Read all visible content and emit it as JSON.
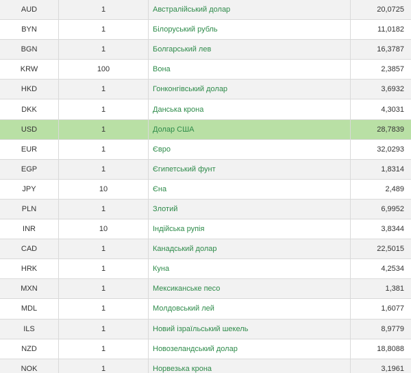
{
  "table": {
    "highlight_color": "#b9e0a5",
    "link_color": "#2e8b4a",
    "stripe_color": "#f2f2f2",
    "rows": [
      {
        "code": "AUD",
        "units": "1",
        "name": "Австралійський долар",
        "rate": "20,0725",
        "highlight": false
      },
      {
        "code": "BYN",
        "units": "1",
        "name": "Білоруський рубль",
        "rate": "11,0182",
        "highlight": false
      },
      {
        "code": "BGN",
        "units": "1",
        "name": "Болгарський лев",
        "rate": "16,3787",
        "highlight": false
      },
      {
        "code": "KRW",
        "units": "100",
        "name": "Вона",
        "rate": "2,3857",
        "highlight": false
      },
      {
        "code": "HKD",
        "units": "1",
        "name": "Гонконгівський долар",
        "rate": "3,6932",
        "highlight": false
      },
      {
        "code": "DKK",
        "units": "1",
        "name": "Данська крона",
        "rate": "4,3031",
        "highlight": false
      },
      {
        "code": "USD",
        "units": "1",
        "name": "Долар США",
        "rate": "28,7839",
        "highlight": true
      },
      {
        "code": "EUR",
        "units": "1",
        "name": "Євро",
        "rate": "32,0293",
        "highlight": false
      },
      {
        "code": "EGP",
        "units": "1",
        "name": "Єгипетський фунт",
        "rate": "1,8314",
        "highlight": false
      },
      {
        "code": "JPY",
        "units": "10",
        "name": "Єна",
        "rate": "2,489",
        "highlight": false
      },
      {
        "code": "PLN",
        "units": "1",
        "name": "Злотий",
        "rate": "6,9952",
        "highlight": false
      },
      {
        "code": "INR",
        "units": "10",
        "name": "Індійська рупія",
        "rate": "3,8344",
        "highlight": false
      },
      {
        "code": "CAD",
        "units": "1",
        "name": "Канадський долар",
        "rate": "22,5015",
        "highlight": false
      },
      {
        "code": "HRK",
        "units": "1",
        "name": "Куна",
        "rate": "4,2534",
        "highlight": false
      },
      {
        "code": "MXN",
        "units": "1",
        "name": "Мексиканське песо",
        "rate": "1,381",
        "highlight": false
      },
      {
        "code": "MDL",
        "units": "1",
        "name": "Молдовський лей",
        "rate": "1,6077",
        "highlight": false
      },
      {
        "code": "ILS",
        "units": "1",
        "name": "Новий ізраїльський шекель",
        "rate": "8,9779",
        "highlight": false
      },
      {
        "code": "NZD",
        "units": "1",
        "name": "Новозеландський долар",
        "rate": "18,8088",
        "highlight": false
      },
      {
        "code": "NOK",
        "units": "1",
        "name": "Норвезька крона",
        "rate": "3,1961",
        "highlight": false
      }
    ]
  }
}
